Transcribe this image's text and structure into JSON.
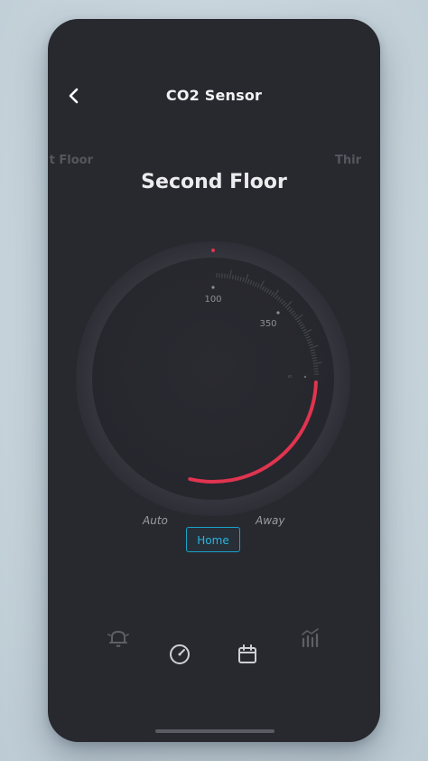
{
  "header": {
    "title": "CO2 Sensor"
  },
  "floors": {
    "previous": "t Floor",
    "current": "Second Floor",
    "next": "Thir"
  },
  "dial": {
    "scale_labels": {
      "label_100": "100",
      "label_350": "350",
      "label_small": "ιn"
    },
    "accent_color": "#e0344f",
    "track_color": "#33333b"
  },
  "modes": {
    "auto": "Auto",
    "home": "Home",
    "away": "Away",
    "selected": "Home"
  },
  "bottom_nav": {
    "items": [
      {
        "icon": "bell-icon",
        "active": false
      },
      {
        "icon": "gauge-icon",
        "active": true
      },
      {
        "icon": "calendar-icon",
        "active": true
      },
      {
        "icon": "bar-chart-icon",
        "active": false
      }
    ]
  },
  "colors": {
    "screen_bg": "#28282f",
    "home_mode_accent": "#28b6df"
  }
}
